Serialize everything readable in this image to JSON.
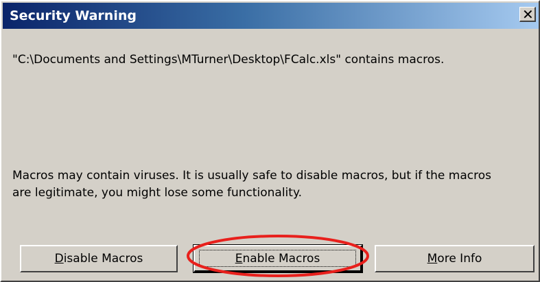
{
  "dialog": {
    "title": "Security Warning",
    "close_icon": "close-icon",
    "message_file": "\"C:\\Documents and Settings\\MTurner\\Desktop\\FCalc.xls\" contains macros.",
    "message_warning": "Macros may contain viruses. It is usually safe to disable macros, but if the macros are legitimate, you might lose some functionality."
  },
  "buttons": {
    "disable": {
      "mnemonic": "D",
      "rest": "isable Macros"
    },
    "enable": {
      "mnemonic": "E",
      "rest": "nable Macros"
    },
    "more_info": {
      "before": "",
      "mnemonic": "M",
      "rest": "ore Info"
    }
  },
  "colors": {
    "dialog_face": "#d4d0c8",
    "title_start": "#0a246a",
    "title_end": "#a6caf0",
    "highlight_ellipse": "#e8201c"
  }
}
